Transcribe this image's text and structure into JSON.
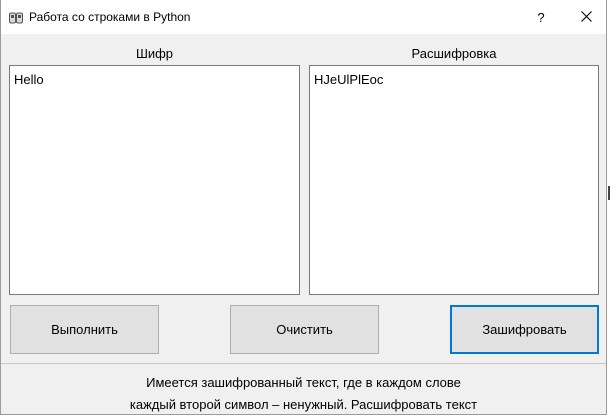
{
  "window": {
    "title": "Работа со строками в Python",
    "help_label": "?",
    "close_label": "✕",
    "app_icon": "python-app-icon"
  },
  "panels": {
    "left_label": "Шифр",
    "right_label": "Расшифровка",
    "left_text": "Hello",
    "right_text": "HJeUlPlEoc"
  },
  "buttons": {
    "run_label": "Выполнить",
    "clear_label": "Очистить",
    "encrypt_label": "Зашифровать"
  },
  "status": {
    "line1": "Имеется зашифрованный текст, где в каждом слове",
    "line2": "каждый второй символ – ненужный. Расшифровать текст"
  },
  "colors": {
    "focus_border": "#0078d7",
    "button_bg": "#e1e1e1",
    "window_bg": "#f0f0f0"
  }
}
